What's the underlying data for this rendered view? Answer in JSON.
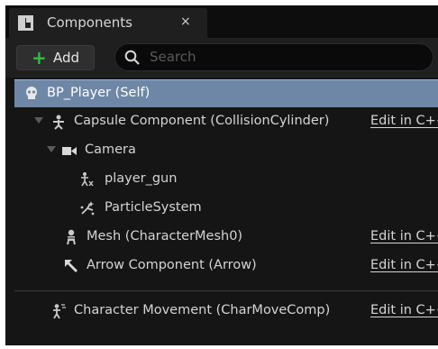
{
  "tab": {
    "title": "Components",
    "close": "×"
  },
  "toolbar": {
    "add_label": "Add",
    "search_placeholder": "Search"
  },
  "tree": {
    "root": "BP_Player (Self)",
    "capsule": "Capsule Component (CollisionCylinder)",
    "camera": "Camera",
    "player_gun": "player_gun",
    "particle": "ParticleSystem",
    "mesh": "Mesh (CharacterMesh0)",
    "arrow": "Arrow Component (Arrow)",
    "movement": "Character Movement (CharMoveComp)",
    "edit_link": "Edit in C++"
  },
  "colors": {
    "selection": "#6f87a6",
    "add_icon": "#2fbf3f",
    "panel": "#151515"
  }
}
